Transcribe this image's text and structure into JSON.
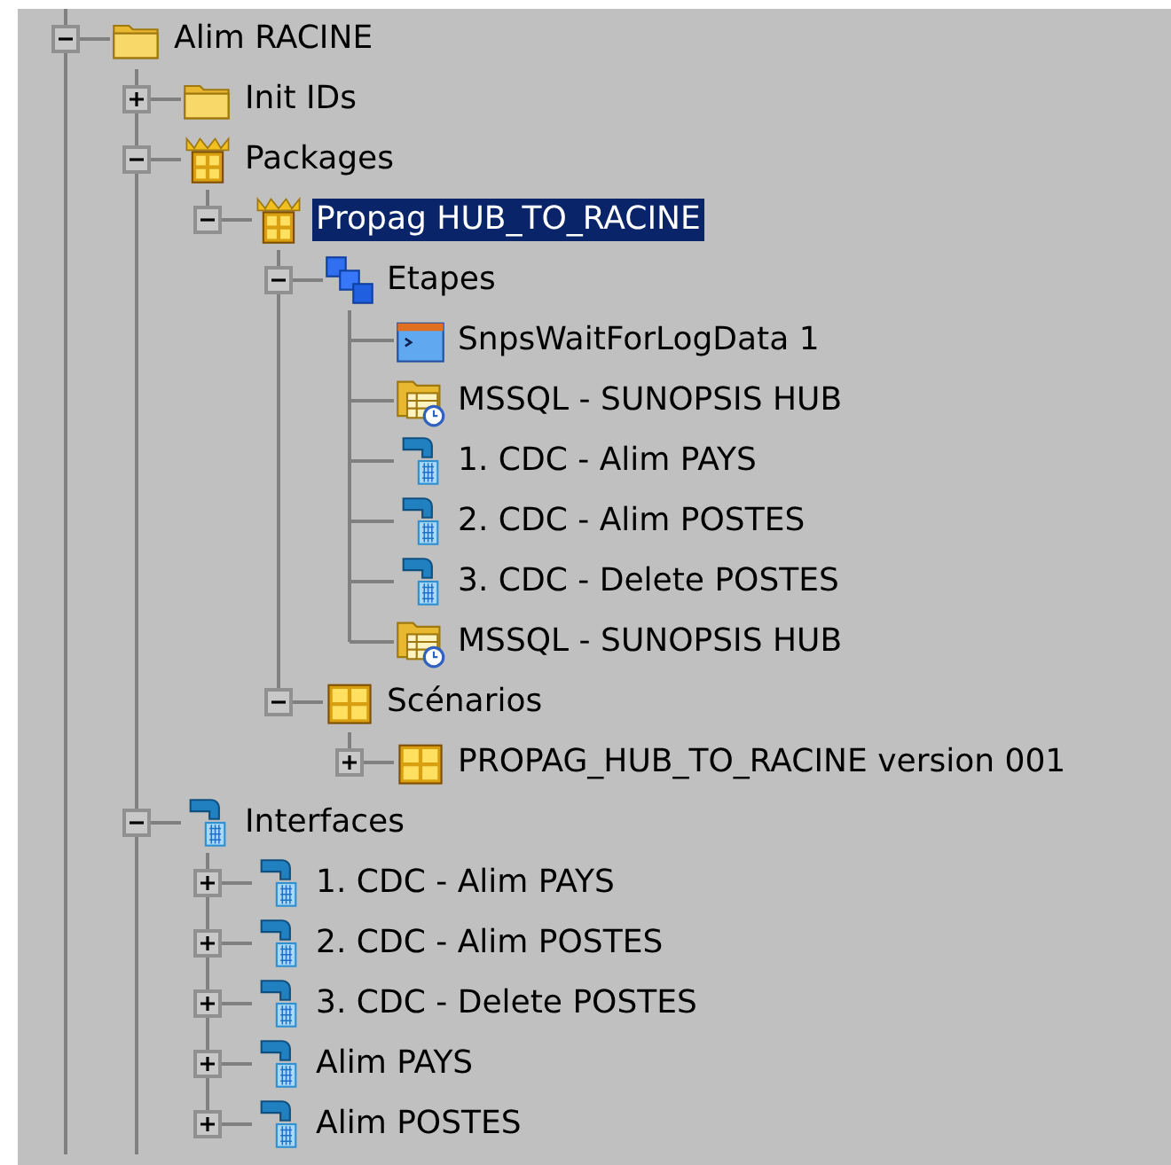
{
  "tree": [
    {
      "label": "Alim RACINE",
      "kind": "folder",
      "expanded": true,
      "selected": false,
      "more_below": true,
      "children": [
        {
          "label": "Init IDs",
          "kind": "folder",
          "expanded": false,
          "selected": false
        },
        {
          "label": "Packages",
          "kind": "package",
          "expanded": true,
          "selected": false,
          "children": [
            {
              "label": "Propag HUB_TO_RACINE",
              "kind": "package",
              "expanded": true,
              "selected": true,
              "children": [
                {
                  "label": "Etapes",
                  "kind": "steps",
                  "expanded": true,
                  "selected": false,
                  "children": [
                    {
                      "label": "SnpsWaitForLogData 1",
                      "kind": "procedure",
                      "selected": false
                    },
                    {
                      "label": "MSSQL - SUNOPSIS HUB",
                      "kind": "datastore",
                      "selected": false
                    },
                    {
                      "label": "1. CDC - Alim PAYS",
                      "kind": "interface",
                      "selected": false
                    },
                    {
                      "label": "2. CDC - Alim POSTES",
                      "kind": "interface",
                      "selected": false
                    },
                    {
                      "label": "3. CDC - Delete POSTES",
                      "kind": "interface",
                      "selected": false
                    },
                    {
                      "label": "MSSQL - SUNOPSIS HUB",
                      "kind": "datastore",
                      "selected": false
                    }
                  ]
                },
                {
                  "label": "Scénarios",
                  "kind": "scenario",
                  "expanded": true,
                  "selected": false,
                  "children": [
                    {
                      "label": "PROPAG_HUB_TO_RACINE version 001",
                      "kind": "scenario",
                      "expanded": false,
                      "selected": false
                    }
                  ]
                }
              ]
            }
          ]
        },
        {
          "label": "Interfaces",
          "kind": "interface",
          "expanded": true,
          "selected": false,
          "more_below": true,
          "children": [
            {
              "label": "1. CDC - Alim PAYS",
              "kind": "interface",
              "expanded": false,
              "selected": false
            },
            {
              "label": "2. CDC - Alim POSTES",
              "kind": "interface",
              "expanded": false,
              "selected": false
            },
            {
              "label": "3. CDC - Delete POSTES",
              "kind": "interface",
              "expanded": false,
              "selected": false
            },
            {
              "label": "Alim PAYS",
              "kind": "interface",
              "expanded": false,
              "selected": false
            },
            {
              "label": "Alim POSTES",
              "kind": "interface",
              "expanded": false,
              "selected": false
            }
          ]
        }
      ]
    }
  ]
}
